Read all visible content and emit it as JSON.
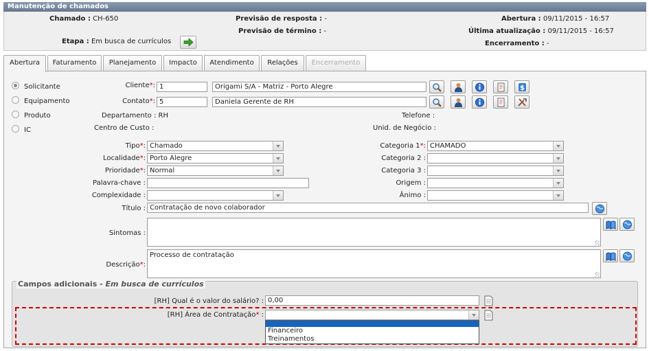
{
  "window": {
    "title": "Manutenção de chamados"
  },
  "header": {
    "chamado_label": "Chamado :",
    "chamado_value": "CH-650",
    "previsao_resposta_label": "Previsão de resposta :",
    "previsao_resposta_value": "-",
    "abertura_label": "Abertura :",
    "abertura_value": "09/11/2015 - 16:57",
    "previsao_termino_label": "Previsão de término :",
    "previsao_termino_value": "-",
    "ultima_atualizacao_label": "Última atualização :",
    "ultima_atualizacao_value": "09/11/2015 - 16:57",
    "etapa_label": "Etapa :",
    "etapa_value": "Em busca de currículos",
    "encerramento_label": "Encerramento :",
    "encerramento_value": "-",
    "go_icon": "arrow-right-icon"
  },
  "tabs": [
    {
      "label": "Abertura",
      "state": "active"
    },
    {
      "label": "Faturamento",
      "state": "normal"
    },
    {
      "label": "Planejamento",
      "state": "normal"
    },
    {
      "label": "Impacto",
      "state": "normal"
    },
    {
      "label": "Atendimento",
      "state": "normal"
    },
    {
      "label": "Relações",
      "state": "normal"
    },
    {
      "label": "Encerramento",
      "state": "disabled"
    }
  ],
  "requester_type": {
    "options": [
      "Solicitante",
      "Equipamento",
      "Produto",
      "IC"
    ],
    "selected": "Solicitante"
  },
  "form": {
    "cliente_label": "Cliente",
    "cliente_code": "1",
    "cliente_name": "Origami S/A - Matriz - Porto Alegre",
    "contato_label": "Contato",
    "contato_code": "5",
    "contato_name": "Daniela Gerente de RH",
    "departamento_label": "Departamento :",
    "departamento_value": "RH",
    "telefone_label": "Telefone :",
    "centro_custo_label": "Centro de Custo :",
    "unid_negocio_label": "Unid. de Negócio :",
    "tipo_label": "Tipo",
    "tipo_value": "Chamado",
    "localidade_label": "Localidade",
    "localidade_value": "Porto Alegre",
    "prioridade_label": "Prioridade",
    "prioridade_value": "Normal",
    "palavra_chave_label": "Palavra-chave :",
    "palavra_chave_value": "",
    "complexidade_label": "Complexidade :",
    "complexidade_value": "",
    "categoria1_label": "Categoria 1",
    "categoria1_value": "CHAMADO",
    "categoria2_label": "Categoria 2 :",
    "categoria2_value": "",
    "categoria3_label": "Categoria 3 :",
    "categoria3_value": "",
    "origem_label": "Origem :",
    "origem_value": "",
    "animo_label": "Ânimo :",
    "animo_value": "",
    "titulo_label": "Título :",
    "titulo_value": "Contratação de novo colaborador",
    "sintomas_label": "Sintomas :",
    "sintomas_value": "",
    "descricao_label": "Descrição",
    "descricao_value": "Processo de contratação",
    "required_mark": "*"
  },
  "campos_adicionais": {
    "legend_prefix": "Campos adicionais - ",
    "legend_stage": "Em busca de currículos",
    "salario_label": "[RH] Qual é o valor do salário? :",
    "salario_value": "0,00",
    "area_label": "[RH] Área de Contratação",
    "area_value": "",
    "area_options": [
      "",
      "Financeiro",
      "Treinamentos"
    ]
  }
}
